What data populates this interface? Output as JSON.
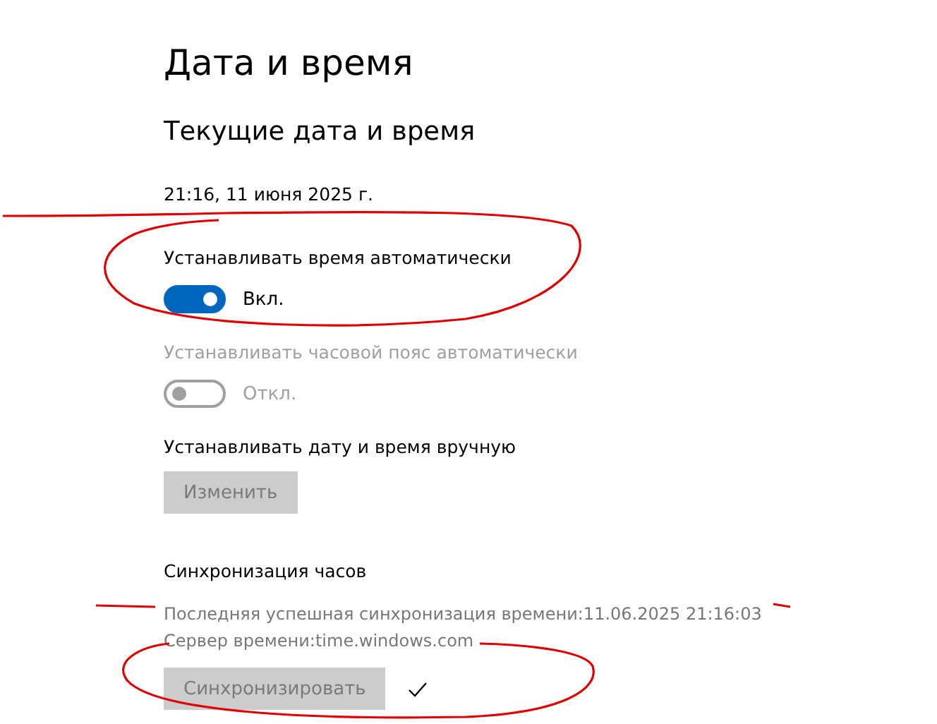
{
  "page_title": "Дата и время",
  "section_title": "Текущие дата и время",
  "current_datetime": "21:16, 11 июня 2025 г.",
  "settings": [
    {
      "kind": "toggle",
      "label": "Устанавливать время автоматически",
      "on": true,
      "disabled": false,
      "state_text": "Вкл."
    },
    {
      "kind": "toggle",
      "label": "Устанавливать часовой пояс автоматически",
      "on": false,
      "disabled": true,
      "state_text": "Откл."
    },
    {
      "kind": "button",
      "label": "Устанавливать дату и время вручную",
      "button_text": "Изменить",
      "disabled": true
    }
  ],
  "sync": {
    "title": "Синхронизация часов",
    "last_sync": "Последняя успешная синхронизация времени:11.06.2025 21:16:03",
    "server": "Сервер времени:time.windows.com",
    "button_text": "Синхронизировать",
    "button_disabled": true,
    "synced": true
  }
}
